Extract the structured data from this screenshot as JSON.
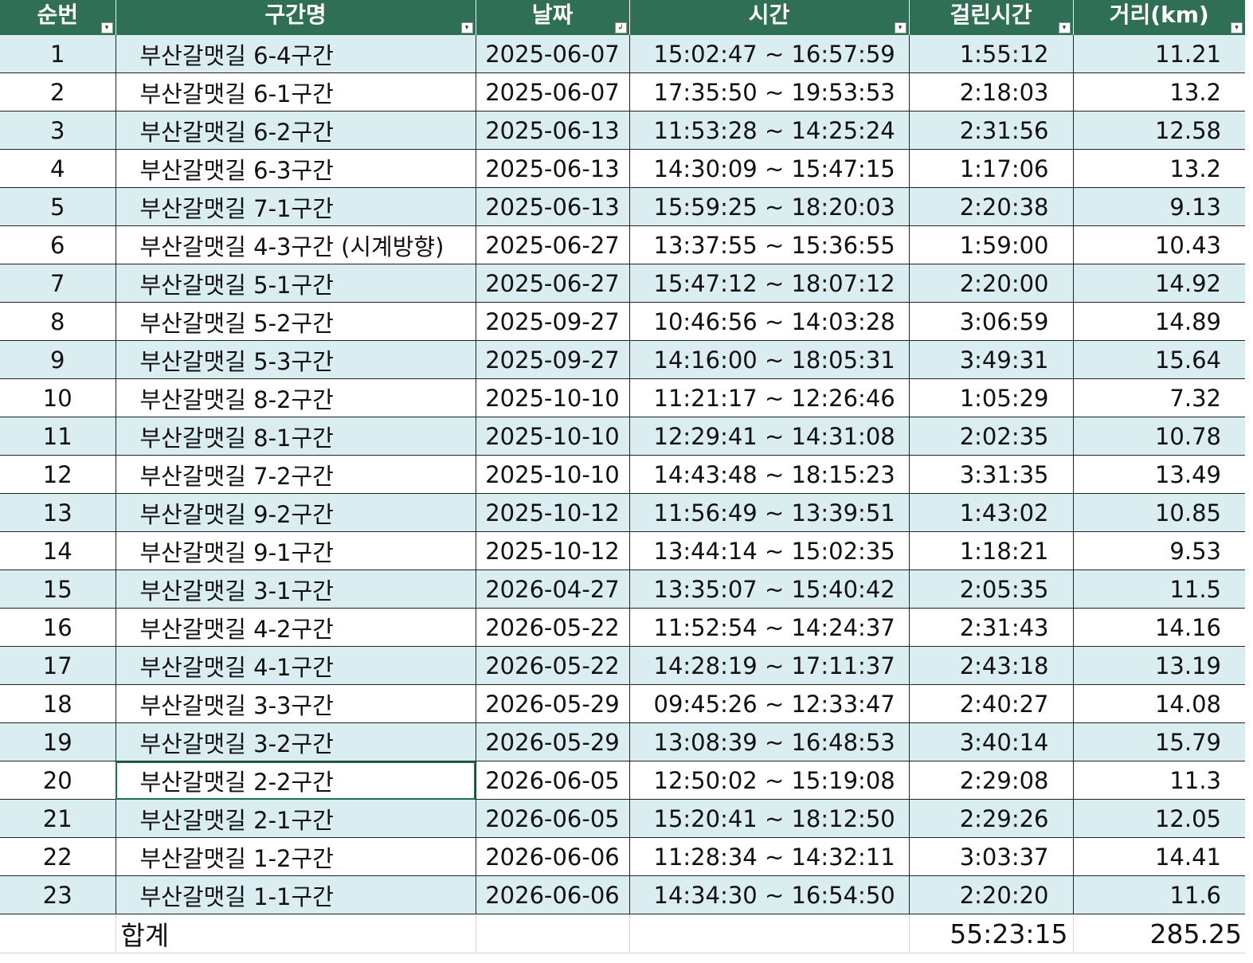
{
  "table": {
    "headers": [
      "순번",
      "구간명",
      "날짜",
      "시간",
      "걸린시간",
      "거리(km)"
    ],
    "filter_icons": [
      "dropdown-filter",
      "dropdown-filter",
      "sort-filter",
      "dropdown-filter",
      "dropdown-filter",
      "dropdown-filter"
    ],
    "rows": [
      [
        "1",
        "부산갈맷길 6-4구간",
        "2025-06-07",
        "15:02:47 ~ 16:57:59",
        "1:55:12",
        "11.21"
      ],
      [
        "2",
        "부산갈맷길 6-1구간",
        "2025-06-07",
        "17:35:50 ~ 19:53:53",
        "2:18:03",
        "13.2"
      ],
      [
        "3",
        "부산갈맷길 6-2구간",
        "2025-06-13",
        "11:53:28 ~ 14:25:24",
        "2:31:56",
        "12.58"
      ],
      [
        "4",
        "부산갈맷길 6-3구간",
        "2025-06-13",
        "14:30:09 ~ 15:47:15",
        "1:17:06",
        "13.2"
      ],
      [
        "5",
        "부산갈맷길 7-1구간",
        "2025-06-13",
        "15:59:25 ~ 18:20:03",
        "2:20:38",
        "9.13"
      ],
      [
        "6",
        "부산갈맷길 4-3구간 (시계방향)",
        "2025-06-27",
        "13:37:55 ~ 15:36:55",
        "1:59:00",
        "10.43"
      ],
      [
        "7",
        "부산갈맷길 5-1구간",
        "2025-06-27",
        "15:47:12 ~ 18:07:12",
        "2:20:00",
        "14.92"
      ],
      [
        "8",
        "부산갈맷길 5-2구간",
        "2025-09-27",
        "10:46:56 ~ 14:03:28",
        "3:06:59",
        "14.89"
      ],
      [
        "9",
        "부산갈맷길 5-3구간",
        "2025-09-27",
        "14:16:00 ~ 18:05:31",
        "3:49:31",
        "15.64"
      ],
      [
        "10",
        "부산갈맷길 8-2구간",
        "2025-10-10",
        "11:21:17 ~ 12:26:46",
        "1:05:29",
        "7.32"
      ],
      [
        "11",
        "부산갈맷길 8-1구간",
        "2025-10-10",
        "12:29:41 ~ 14:31:08",
        "2:02:35",
        "10.78"
      ],
      [
        "12",
        "부산갈맷길 7-2구간",
        "2025-10-10",
        "14:43:48 ~ 18:15:23",
        "3:31:35",
        "13.49"
      ],
      [
        "13",
        "부산갈맷길 9-2구간",
        "2025-10-12",
        "11:56:49 ~ 13:39:51",
        "1:43:02",
        "10.85"
      ],
      [
        "14",
        "부산갈맷길 9-1구간",
        "2025-10-12",
        "13:44:14 ~ 15:02:35",
        "1:18:21",
        "9.53"
      ],
      [
        "15",
        "부산갈맷길 3-1구간",
        "2026-04-27",
        "13:35:07 ~ 15:40:42",
        "2:05:35",
        "11.5"
      ],
      [
        "16",
        "부산갈맷길 4-2구간",
        "2026-05-22",
        "11:52:54 ~ 14:24:37",
        "2:31:43",
        "14.16"
      ],
      [
        "17",
        "부산갈맷길 4-1구간",
        "2026-05-22",
        "14:28:19 ~ 17:11:37",
        "2:43:18",
        "13.19"
      ],
      [
        "18",
        "부산갈맷길 3-3구간",
        "2026-05-29",
        "09:45:26 ~ 12:33:47",
        "2:40:27",
        "14.08"
      ],
      [
        "19",
        "부산갈맷길 3-2구간",
        "2026-05-29",
        "13:08:39 ~ 16:48:53",
        "3:40:14",
        "15.79"
      ],
      [
        "20",
        "부산갈맷길 2-2구간",
        "2026-06-05",
        "12:50:02 ~ 15:19:08",
        "2:29:08",
        "11.3"
      ],
      [
        "21",
        "부산갈맷길 2-1구간",
        "2026-06-05",
        "15:20:41 ~ 18:12:50",
        "2:29:26",
        "12.05"
      ],
      [
        "22",
        "부산갈맷길 1-2구간",
        "2026-06-06",
        "11:28:34 ~ 14:32:11",
        "3:03:37",
        "14.41"
      ],
      [
        "23",
        "부산갈맷길 1-1구간",
        "2026-06-06",
        "14:34:30 ~ 16:54:50",
        "2:20:20",
        "11.6"
      ]
    ],
    "selected_cell": {
      "row": 20,
      "column": "구간명"
    },
    "totals": {
      "label": "합계",
      "duration": "55:23:15",
      "distance": "285.25"
    }
  },
  "colors": {
    "header_bg": "#2f6f55",
    "band_row_bg": "#daeef2",
    "selection_border": "#1e7145"
  }
}
